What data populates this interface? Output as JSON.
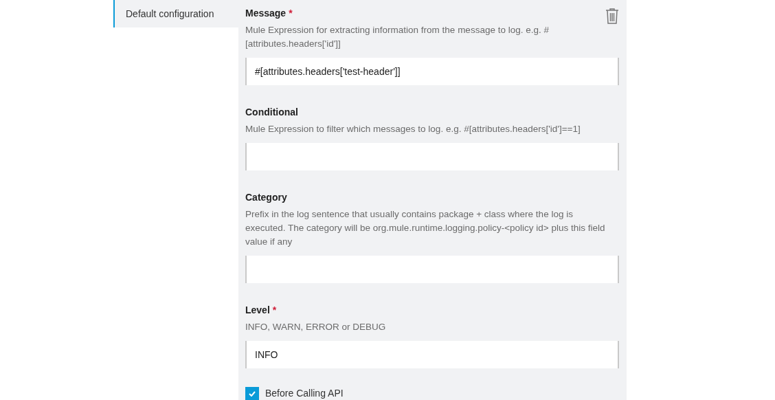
{
  "sidebar": {
    "items": [
      {
        "label": "Default configuration",
        "selected": true
      }
    ]
  },
  "fields": [
    {
      "label": "Message",
      "required": true,
      "description": "Mule Expression for extracting information from the message to log. e.g. #[attributes.headers['id']]",
      "value": "#[attributes.headers['test-header']]"
    },
    {
      "label": "Conditional",
      "required": false,
      "description": "Mule Expression to filter which messages to log. e.g. #[attributes.headers['id']==1]"
    },
    {
      "label": "Category",
      "required": false,
      "description": "Prefix in the log sentence that usually contains package + class where the log is executed. The category will be org.mule.runtime.logging.policy-<policy id> plus this field value if any"
    },
    {
      "label": "Level",
      "required": true,
      "description": "INFO, WARN, ERROR or DEBUG",
      "value": "INFO"
    }
  ],
  "checkbox": {
    "label": "Before Calling API",
    "checked": true
  },
  "required_mark": "*"
}
